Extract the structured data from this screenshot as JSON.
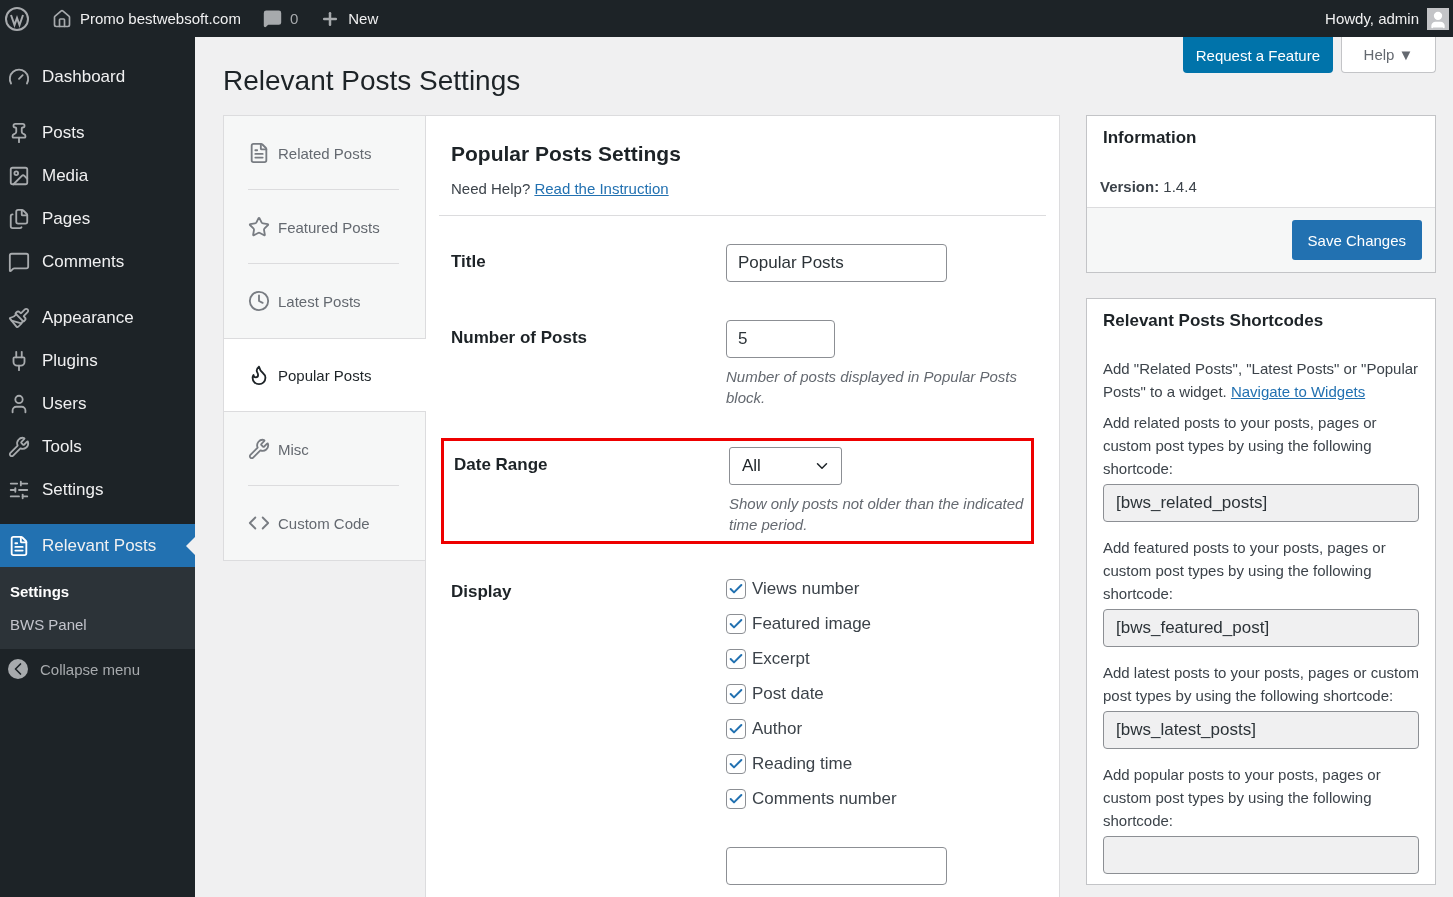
{
  "admin_bar": {
    "site": "Promo bestwebsoft.com",
    "comments": "0",
    "new": "New",
    "howdy": "Howdy, admin"
  },
  "sidebar": {
    "groups": [
      [
        {
          "label": "Dashboard",
          "selected": false
        }
      ],
      [
        {
          "label": "Posts",
          "selected": false
        },
        {
          "label": "Media",
          "selected": false
        },
        {
          "label": "Pages",
          "selected": false
        },
        {
          "label": "Comments",
          "selected": false
        }
      ],
      [
        {
          "label": "Appearance",
          "selected": false
        },
        {
          "label": "Plugins",
          "selected": false
        },
        {
          "label": "Users",
          "selected": false
        },
        {
          "label": "Tools",
          "selected": false
        },
        {
          "label": "Settings",
          "selected": false
        }
      ],
      [
        {
          "label": "Relevant Posts",
          "selected": true,
          "children": [
            {
              "label": "Settings",
              "selected": true
            },
            {
              "label": "BWS Panel",
              "selected": false
            }
          ]
        }
      ]
    ],
    "collapse": "Collapse menu"
  },
  "header_buttons": {
    "request": "Request a Feature",
    "help": "Help ▼"
  },
  "page_title": "Relevant Posts Settings",
  "tabs": [
    {
      "label": "Related Posts",
      "selected": false
    },
    {
      "label": "Featured Posts",
      "selected": false
    },
    {
      "label": "Latest Posts",
      "selected": false
    },
    {
      "label": "Popular Posts",
      "selected": true
    },
    {
      "label": "Misc",
      "selected": false
    },
    {
      "label": "Custom Code",
      "selected": false
    }
  ],
  "settings": {
    "heading": "Popular Posts Settings",
    "help_text": "Need Help?",
    "help_link": "Read the Instruction",
    "rows": [
      {
        "kind": "text",
        "label": "Title",
        "value": "Popular Posts",
        "highlighted": false
      },
      {
        "kind": "number",
        "label": "Number of Posts",
        "value": "5",
        "description": "Number of posts displayed in Popular Posts block.",
        "highlighted": false
      },
      {
        "kind": "select",
        "label": "Date Range",
        "value": "All",
        "description": "Show only posts not older than the indicated time period.",
        "highlighted": true
      },
      {
        "kind": "checkboxes",
        "label": "Display",
        "highlighted": false,
        "options": [
          {
            "label": "Views number",
            "checked": true
          },
          {
            "label": "Featured image",
            "checked": true
          },
          {
            "label": "Excerpt",
            "checked": true
          },
          {
            "label": "Post date",
            "checked": true
          },
          {
            "label": "Author",
            "checked": true
          },
          {
            "label": "Reading time",
            "checked": true
          },
          {
            "label": "Comments number",
            "checked": true
          }
        ]
      },
      {
        "kind": "text",
        "highlighted": false
      }
    ]
  },
  "information": {
    "title": "Information",
    "version_label": "Version:",
    "version": "1.4.4",
    "save": "Save Changes"
  },
  "shortcodes": {
    "title": "Relevant Posts Shortcodes",
    "intro": "Add \"Related Posts\", \"Latest Posts\" or \"Popular Posts\" to a widget.",
    "intro_link": "Navigate to Widgets",
    "items": [
      {
        "text": "Add related posts to your posts, pages or custom post types by using the following shortcode:",
        "shortcode": "[bws_related_posts]"
      },
      {
        "text": "Add featured posts to your posts, pages or custom post types by using the following shortcode:",
        "shortcode": "[bws_featured_post]"
      },
      {
        "text": "Add latest posts to your posts, pages or custom post types by using the following shortcode:",
        "shortcode": "[bws_latest_posts]"
      },
      {
        "text": "Add popular posts to your posts, pages or custom post types by using the following shortcode:",
        "has_field": true
      }
    ]
  }
}
